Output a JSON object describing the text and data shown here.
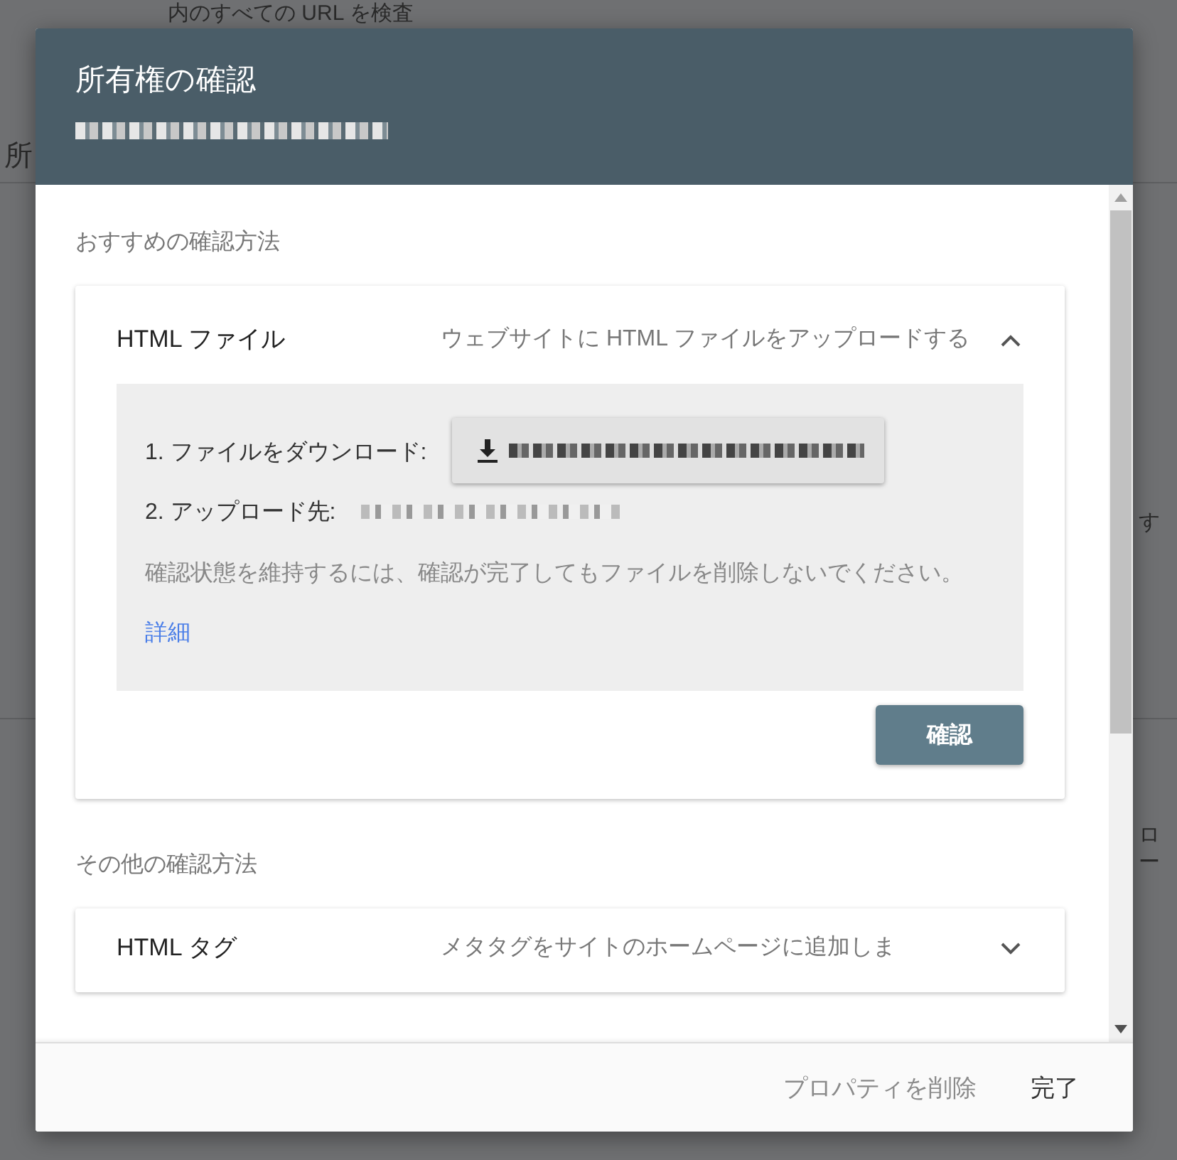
{
  "background_page": {
    "top_text": "内のすべての URL を検査",
    "left_text": "所",
    "right_texts": [
      "す",
      "ロー"
    ]
  },
  "dialog": {
    "title": "所有権の確認",
    "recommended_heading": "おすすめの確認方法",
    "recommended_method": {
      "name": "HTML ファイル",
      "description": "ウェブサイトに HTML ファイルをアップロードする",
      "expanded": true,
      "steps": [
        {
          "label": "1. ファイルをダウンロード:",
          "kind": "download"
        },
        {
          "label": "2. アップロード先:",
          "kind": "destination"
        }
      ],
      "note": "確認状態を維持するには、確認が完了してもファイルを削除しないでください。",
      "link": "詳細",
      "verify_button": "確認"
    },
    "other_heading": "その他の確認方法",
    "other_methods": [
      {
        "name": "HTML タグ",
        "description": "メタタグをサイトのホームページに追加しま",
        "expanded": false
      }
    ],
    "footer_buttons": [
      {
        "label": "プロパティを削除",
        "kind": "secondary"
      },
      {
        "label": "完了",
        "kind": "primary"
      }
    ]
  }
}
